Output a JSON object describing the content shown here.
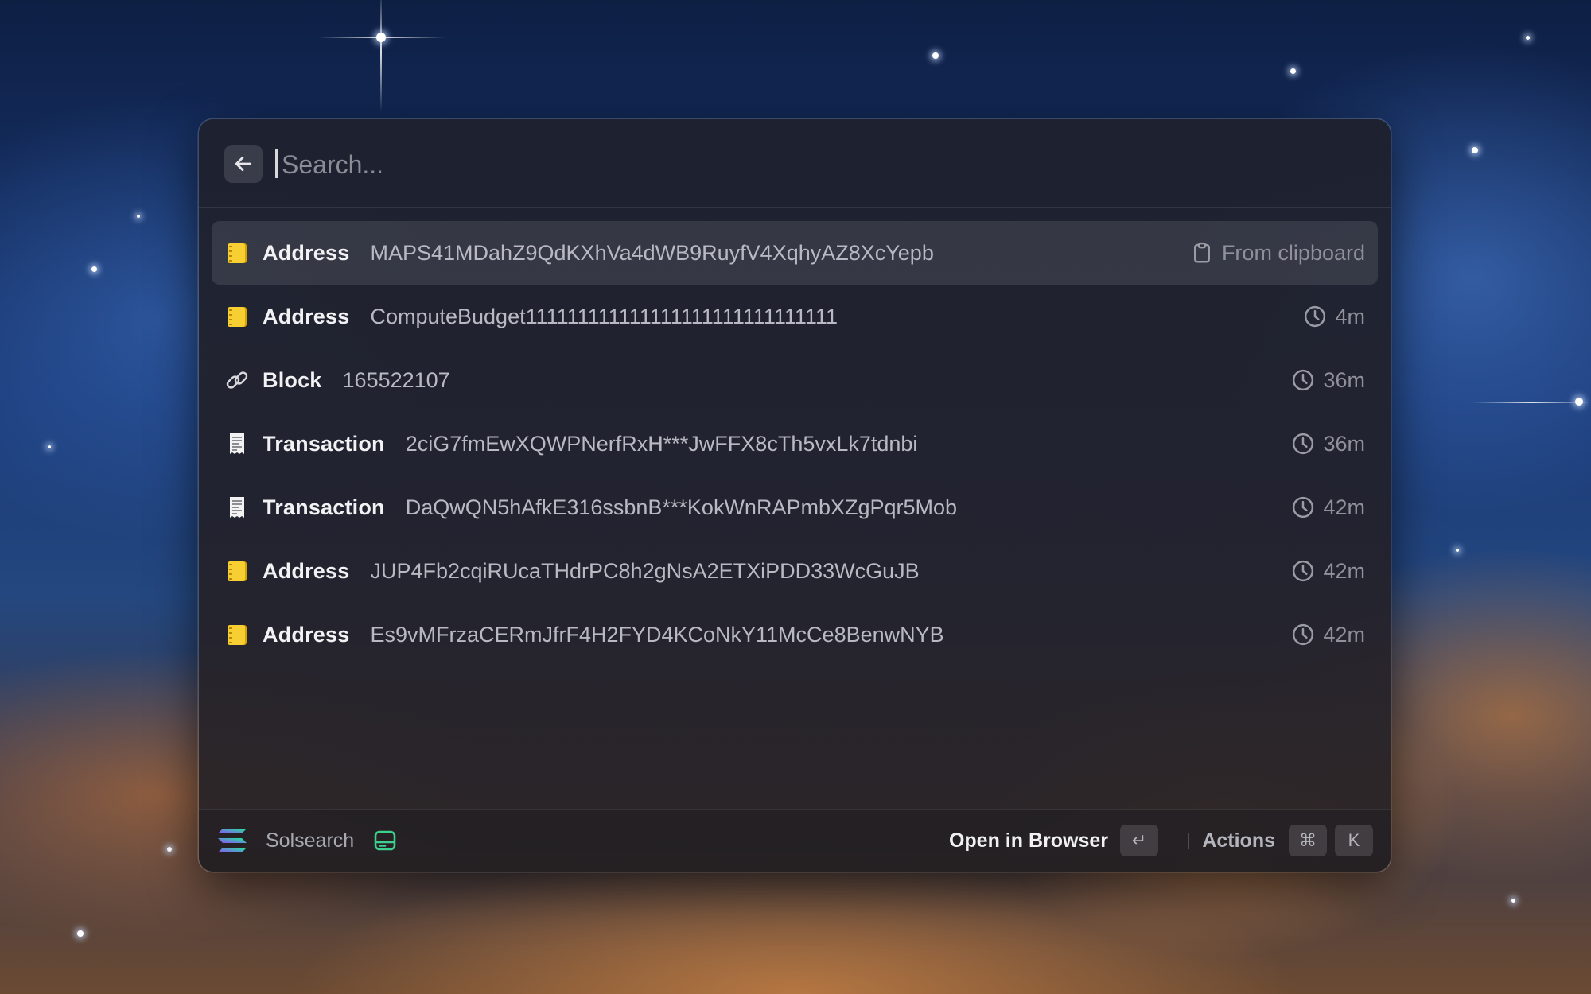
{
  "search": {
    "placeholder": "Search..."
  },
  "results": [
    {
      "type": "Address",
      "value": "MAPS41MDahZ9QdKXhVa4dWB9RuyfV4XqhyAZ8XcYepb",
      "accessory": "From clipboard",
      "accessory_icon": "clipboard-icon",
      "icon": "ledger-icon",
      "selected": true
    },
    {
      "type": "Address",
      "value": "ComputeBudget111111111111111111111111111111",
      "accessory": "4m",
      "accessory_icon": "clock-icon",
      "icon": "ledger-icon"
    },
    {
      "type": "Block",
      "value": "165522107",
      "accessory": "36m",
      "accessory_icon": "clock-icon",
      "icon": "link-icon"
    },
    {
      "type": "Transaction",
      "value": "2ciG7fmEwXQWPNerfRxH***JwFFX8cTh5vxLk7tdnbi",
      "accessory": "36m",
      "accessory_icon": "clock-icon",
      "icon": "receipt-icon"
    },
    {
      "type": "Transaction",
      "value": "DaQwQN5hAfkE316ssbnB***KokWnRAPmbXZgPqr5Mob",
      "accessory": "42m",
      "accessory_icon": "clock-icon",
      "icon": "receipt-icon"
    },
    {
      "type": "Address",
      "value": "JUP4Fb2cqiRUcaTHdrPC8h2gNsA2ETXiPDD33WcGuJB",
      "accessory": "42m",
      "accessory_icon": "clock-icon",
      "icon": "ledger-icon"
    },
    {
      "type": "Address",
      "value": "Es9vMFrzaCERmJfrF4H2FYD4KCoNkY11McCe8BenwNYB",
      "accessory": "42m",
      "accessory_icon": "clock-icon",
      "icon": "ledger-icon"
    }
  ],
  "footer": {
    "app_name": "Solsearch",
    "primary_action": "Open in Browser",
    "primary_shortcut": "↵",
    "actions_label": "Actions",
    "actions_shortcut": [
      "⌘",
      "K"
    ]
  },
  "colors": {
    "accent_green": "#3ccf8e",
    "solana_gradient": [
      "#9945ff",
      "#14f195"
    ]
  }
}
